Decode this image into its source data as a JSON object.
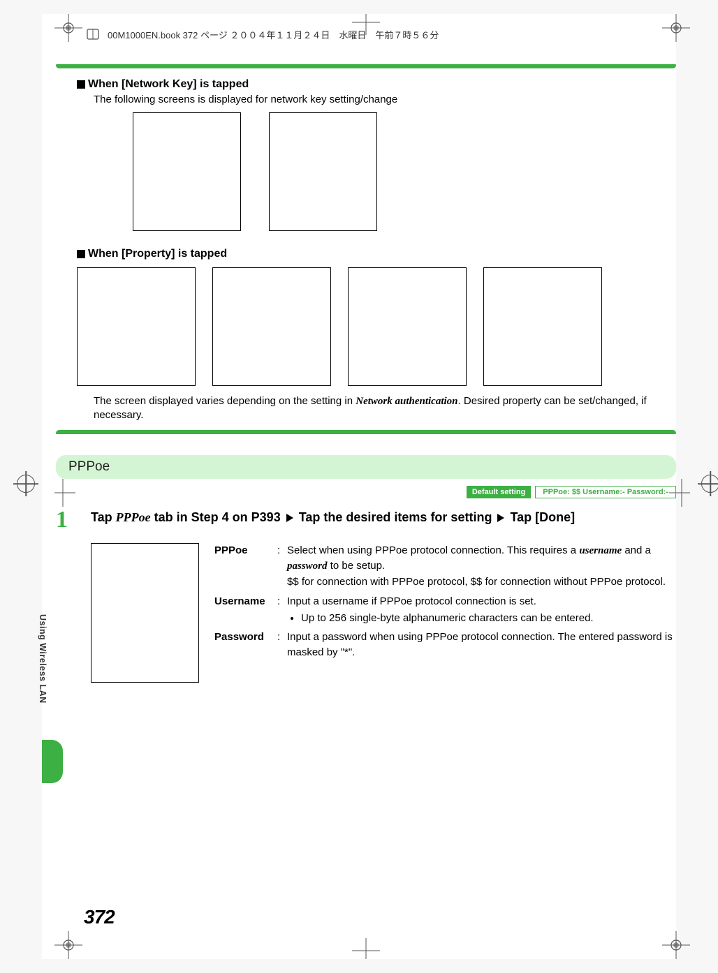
{
  "file_header": "00M1000EN.book  372 ページ  ２００４年１１月２４日　水曜日　午前７時５６分",
  "section1": {
    "heading": "When [Network Key] is tapped",
    "desc": "The following screens is displayed for network key setting/change"
  },
  "section2": {
    "heading": "When [Property] is tapped",
    "note_pre": "The screen displayed varies depending on the setting in ",
    "note_ital": "Network authentication",
    "note_post": ". Desired property can be set/changed, if necessary."
  },
  "pppoe": {
    "title": "PPPoe",
    "default_label": "Default setting",
    "default_value": "PPPoe: $$    Username:-    Password:-",
    "step_num": "1",
    "step": {
      "pre": "Tap ",
      "ital": "PPPoe",
      "mid": " tab in Step 4 on P393 ",
      "mid2": " Tap the desired items for setting ",
      "end": " Tap [Done]"
    },
    "rows": [
      {
        "label": "PPPoe",
        "line1_pre": "Select when using PPPoe protocol connection. This requires a ",
        "line1_i1": "username",
        "line1_mid": " and a ",
        "line1_i2": "password",
        "line1_post": " to be setup.",
        "line2": "$$ for connection with PPPoe protocol, $$ for connection without PPPoe protocol."
      },
      {
        "label": "Username",
        "text": "Input a username if PPPoe protocol connection is set.",
        "bullet": "Up to 256 single-byte alphanumeric characters can be entered."
      },
      {
        "label": "Password",
        "text": "Input a password when using PPPoe protocol connection. The entered password is masked by \"*\"."
      }
    ]
  },
  "side_label": "Using Wireless LAN",
  "page_number": "372"
}
